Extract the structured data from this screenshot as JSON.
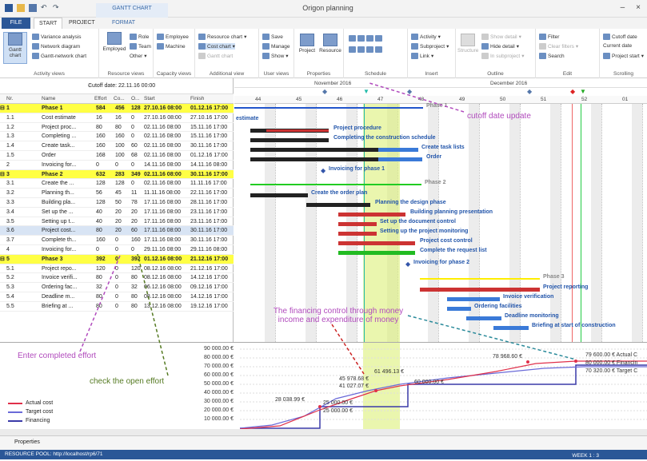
{
  "app": {
    "title": "Origon planning",
    "context_tab": "GANTT CHART",
    "window": {
      "minimize": "–",
      "close": "×"
    }
  },
  "tabs": [
    "FILE",
    "START",
    "PROJECT",
    "FORMAT"
  ],
  "ribbon": {
    "activity_views": {
      "label": "Activity views",
      "gantt": "Gantt chart",
      "variance": "Variance analysis",
      "network": "Network diagram",
      "gantt_network": "Gantt-network chart"
    },
    "resource_views": {
      "label": "Resource views",
      "employed": "Employed",
      "role": "Role",
      "team": "Team",
      "other": "Other"
    },
    "capacity_views": {
      "label": "Capacity views",
      "employee": "Employee",
      "machine": "Machine"
    },
    "additional_view": {
      "label": "Additional view",
      "resource_chart": "Resource chart",
      "cost_chart": "Cost chart",
      "gantt_chart": "Gantt chart"
    },
    "user_views": {
      "label": "User views",
      "save": "Save",
      "manage": "Manage",
      "show": "Show"
    },
    "properties": {
      "label": "Properties",
      "project": "Project",
      "resource": "Resource"
    },
    "schedule": {
      "label": "Schedule"
    },
    "insert": {
      "label": "Insert",
      "activity": "Activity",
      "subproject": "Subproject",
      "link": "Link"
    },
    "outline": {
      "label": "Outline",
      "structure": "Structure",
      "show_detail": "Show detail",
      "hide_detail": "Hide detail",
      "in_subproject": "In subproject"
    },
    "edit": {
      "label": "Edit",
      "filter": "Filter",
      "clear_filters": "Clear filters",
      "search": "Search"
    },
    "scrolling": {
      "label": "Scrolling",
      "cutoff_date": "Cutoff date",
      "current_date": "Current date",
      "project_start": "Project start"
    }
  },
  "grid": {
    "cutoff_label": "Cutoff date: 22.11.16 00:00",
    "columns": [
      "Nr.",
      "Name",
      "Effort",
      "Co...",
      "O...",
      "Start",
      "Finish"
    ],
    "rows": [
      {
        "nr": "1",
        "name": "Phase 1",
        "effort": "584",
        "co": "456",
        "o": "128",
        "start": "27.10.16 08:00",
        "finish": "01.12.16 17:00",
        "phase": true
      },
      {
        "nr": "1.1",
        "name": "Cost estimate",
        "effort": "16",
        "co": "16",
        "o": "0",
        "start": "27.10.16 08:00",
        "finish": "27.10.16 17:00"
      },
      {
        "nr": "1.2",
        "name": "Project proc...",
        "effort": "80",
        "co": "80",
        "o": "0",
        "start": "02.11.16 08:00",
        "finish": "15.11.16 17:00"
      },
      {
        "nr": "1.3",
        "name": "Completing ...",
        "effort": "160",
        "co": "160",
        "o": "0",
        "start": "02.11.16 08:00",
        "finish": "15.11.16 17:00"
      },
      {
        "nr": "1.4",
        "name": "Create task...",
        "effort": "160",
        "co": "100",
        "o": "60",
        "start": "02.11.16 08:00",
        "finish": "30.11.16 17:00"
      },
      {
        "nr": "1.5",
        "name": "Order",
        "effort": "168",
        "co": "100",
        "o": "68",
        "start": "02.11.16 08:00",
        "finish": "01.12.16 17:00"
      },
      {
        "nr": "2",
        "name": "Invoicing for...",
        "effort": "0",
        "co": "0",
        "o": "0",
        "start": "14.11.16 08:00",
        "finish": "14.11.16 08:00"
      },
      {
        "nr": "3",
        "name": "Phase 2",
        "effort": "632",
        "co": "283",
        "o": "349",
        "start": "02.11.16 08:00",
        "finish": "30.11.16 17:00",
        "phase": true
      },
      {
        "nr": "3.1",
        "name": "Create the ...",
        "effort": "128",
        "co": "128",
        "o": "0",
        "start": "02.11.16 08:00",
        "finish": "11.11.16 17:00"
      },
      {
        "nr": "3.2",
        "name": "Planning th...",
        "effort": "56",
        "co": "45",
        "o": "11",
        "start": "11.11.16 08:00",
        "finish": "22.11.16 17:00"
      },
      {
        "nr": "3.3",
        "name": "Building pla...",
        "effort": "128",
        "co": "50",
        "o": "78",
        "start": "17.11.16 08:00",
        "finish": "28.11.16 17:00"
      },
      {
        "nr": "3.4",
        "name": "Set up the ...",
        "effort": "40",
        "co": "20",
        "o": "20",
        "start": "17.11.16 08:00",
        "finish": "23.11.16 17:00"
      },
      {
        "nr": "3.5",
        "name": "Setting up t...",
        "effort": "40",
        "co": "20",
        "o": "20",
        "start": "17.11.16 08:00",
        "finish": "23.11.16 17:00"
      },
      {
        "nr": "3.6",
        "name": "Project cost...",
        "effort": "80",
        "co": "20",
        "o": "60",
        "start": "17.11.16 08:00",
        "finish": "30.11.16 17:00",
        "selected": true
      },
      {
        "nr": "3.7",
        "name": "Complete th...",
        "effort": "160",
        "co": "0",
        "o": "160",
        "start": "17.11.16 08:00",
        "finish": "30.11.16 17:00"
      },
      {
        "nr": "4",
        "name": "Invoicing for...",
        "effort": "0",
        "co": "0",
        "o": "0",
        "start": "29.11.16 08:00",
        "finish": "29.11.16 08:00"
      },
      {
        "nr": "5",
        "name": "Phase 3",
        "effort": "392",
        "co": "0",
        "o": "392",
        "start": "01.12.16 08:00",
        "finish": "21.12.16 17:00",
        "phase": true
      },
      {
        "nr": "5.1",
        "name": "Project repo...",
        "effort": "120",
        "co": "0",
        "o": "120",
        "start": "08.12.16 08:00",
        "finish": "21.12.16 17:00"
      },
      {
        "nr": "5.2",
        "name": "Invoice verifi...",
        "effort": "80",
        "co": "0",
        "o": "80",
        "start": "08.12.16 08:00",
        "finish": "14.12.16 17:00"
      },
      {
        "nr": "5.3",
        "name": "Ordering fac...",
        "effort": "32",
        "co": "0",
        "o": "32",
        "start": "06.12.16 08:00",
        "finish": "09.12.16 17:00"
      },
      {
        "nr": "5.4",
        "name": "Deadline m...",
        "effort": "80",
        "co": "0",
        "o": "80",
        "start": "08.12.16 08:00",
        "finish": "14.12.16 17:00"
      },
      {
        "nr": "5.5",
        "name": "Briefing at ...",
        "effort": "80",
        "co": "0",
        "o": "80",
        "start": "13.12.16 08:00",
        "finish": "19.12.16 17:00"
      }
    ]
  },
  "gantt": {
    "months": [
      "November 2016",
      "December 2016"
    ],
    "weeks": [
      "44",
      "45",
      "46",
      "47",
      "48",
      "49",
      "50",
      "51",
      "52",
      "01"
    ],
    "labels": {
      "estimate": "estimate",
      "procedure": "Project procedure",
      "completing": "Completing the construction schedule",
      "tasklists": "Create task lists",
      "order": "Order",
      "inv1": "Invoicing for phase 1",
      "phase1": "Phase 1",
      "phase2": "Phase 2",
      "createorder": "Create the order plan",
      "planning": "Planning the design phase",
      "building": "Building planning presentation",
      "setup": "Set up the document control",
      "monitoring": "Setting up the project monitoring",
      "cost": "Project cost control",
      "request": "Complete the request list",
      "inv2": "Invoicing for phase 2",
      "phase3": "Phase 3",
      "reporting": "Project reporting",
      "invoice": "Invoice verification",
      "ordering": "Ordering facilities",
      "deadline": "Deadline monitoring",
      "briefing": "Briefing at start of construction"
    }
  },
  "money_chart": {
    "yticks": [
      "90 000.00 €",
      "80 000.00 €",
      "70 000.00 €",
      "60 000.00 €",
      "50 000.00 €",
      "40 000.00 €",
      "30 000.00 €",
      "20 000.00 €",
      "10 000.00 €"
    ],
    "labels": {
      "v1": "28 038.99 €",
      "v2": "25 000.00 €",
      "v3": "25 000.00 €",
      "v4": "45 978.68 €",
      "v5": "41 027.07 €",
      "v6": "61 496.13 €",
      "v7": "60 000.00 €",
      "v8": "78 968.60 €",
      "end1": "79 600.00 € Actual C",
      "end2": "80 000.00 € Financin",
      "end3": "70 320.00 € Target C"
    },
    "legend": [
      {
        "name": "Actual cost",
        "color": "#e0304a"
      },
      {
        "name": "Target cost",
        "color": "#6a6ad8"
      },
      {
        "name": "Financing",
        "color": "#3a3aa8"
      }
    ]
  },
  "annotations": {
    "cutoff": "cutoff date update",
    "financing": "The financing control through money\nincome and expenditure of money",
    "effort": "Enter completed effort",
    "open": "check the open effort"
  },
  "footer": {
    "properties": "Properties",
    "status": "RESOURCE POOL: http://localhost/rp6/71",
    "zoom": "WEEK 1 : 3"
  }
}
